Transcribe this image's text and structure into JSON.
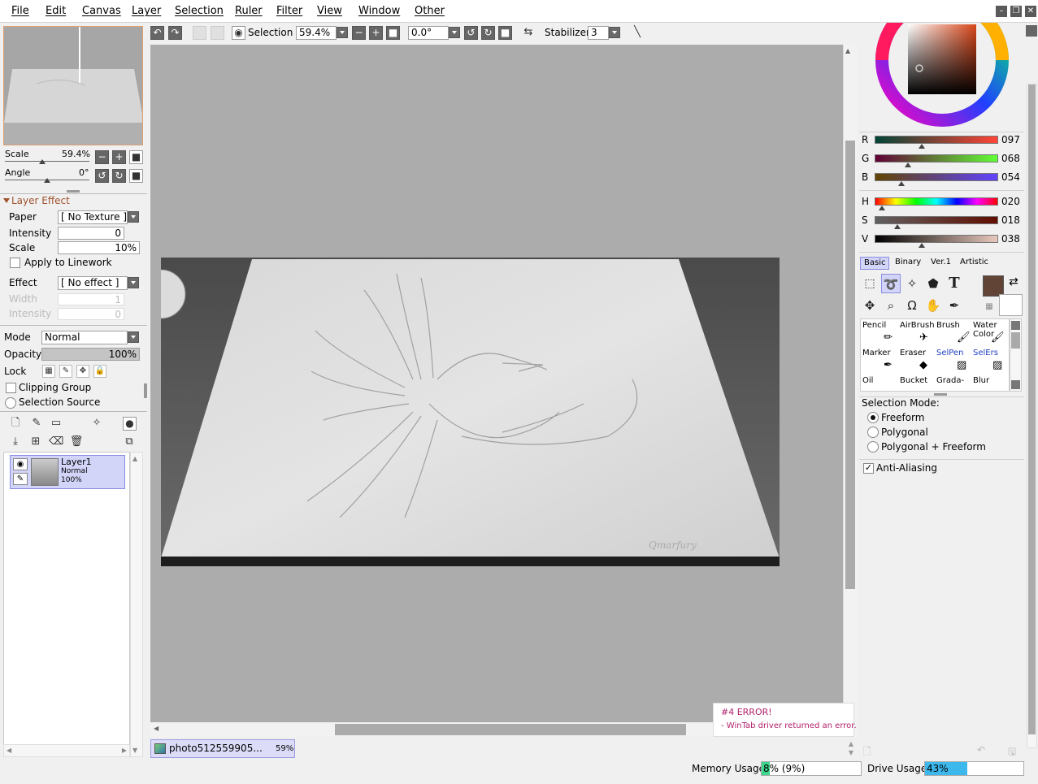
{
  "menu": [
    "File",
    "Edit",
    "Canvas",
    "Layer",
    "Selection",
    "Ruler",
    "Filter",
    "View",
    "Window",
    "Other"
  ],
  "toolbar": {
    "selection_label": "Selection",
    "zoom": "59.4%",
    "rotation": "0.0°",
    "stabilizer_label": "Stabilizer",
    "stabilizer_value": "3"
  },
  "navigator": {
    "scale_label": "Scale",
    "scale_value": "59.4%",
    "angle_label": "Angle",
    "angle_value": "0°"
  },
  "layer_effect": {
    "header": "Layer Effect",
    "paper_label": "Paper",
    "paper_value": "[ No Texture ]",
    "intensity_label": "Intensity",
    "intensity_value": "0",
    "scale_label": "Scale",
    "scale_value": "10%",
    "apply_label": "Apply to Linework",
    "effect_label": "Effect",
    "effect_value": "[ No effect ]",
    "width_label": "Width",
    "width_value": "1",
    "intensity2_label": "Intensity",
    "intensity2_value": "0"
  },
  "layer_props": {
    "mode_label": "Mode",
    "mode_value": "Normal",
    "opacity_label": "Opacity",
    "opacity_value": "100%",
    "opacity_fraction": 1.0,
    "lock_label": "Lock",
    "clipping_label": "Clipping Group",
    "selsource_label": "Selection Source"
  },
  "layers": [
    {
      "name": "Layer1",
      "mode": "Normal",
      "opacity": "100%"
    }
  ],
  "document_tab": {
    "name": "photo512559905...",
    "zoom": "59%"
  },
  "error": {
    "title": "#4 ERROR!",
    "message": "- WinTab driver returned an error."
  },
  "color": {
    "current_hex": "#614436",
    "r_label": "R",
    "r": "097",
    "g_label": "G",
    "g": "068",
    "b_label": "B",
    "b": "054",
    "h_label": "H",
    "h": "020",
    "s_label": "S",
    "s": "018",
    "v_label": "V",
    "v": "038"
  },
  "tool_tabs": [
    "Basic",
    "Binary",
    "Ver.1",
    "Artistic"
  ],
  "brush_tools": [
    [
      "Pencil",
      "AirBrush",
      "Brush",
      "Water Color"
    ],
    [
      "Marker",
      "Eraser",
      "SelPen",
      "SelErs"
    ],
    [
      "Oil",
      "Bucket",
      "Grada-",
      "Blur"
    ]
  ],
  "selection_mode": {
    "label": "Selection Mode:",
    "options": [
      "Freeform",
      "Polygonal",
      "Polygonal + Freeform"
    ],
    "selected": "Freeform",
    "antialias_label": "Anti-Aliasing"
  },
  "status": {
    "memory_label": "Memory Usage",
    "memory_value": "8% (9%)",
    "memory_fraction": 0.08,
    "drive_label": "Drive Usage",
    "drive_value": "43%",
    "drive_fraction": 0.43
  }
}
